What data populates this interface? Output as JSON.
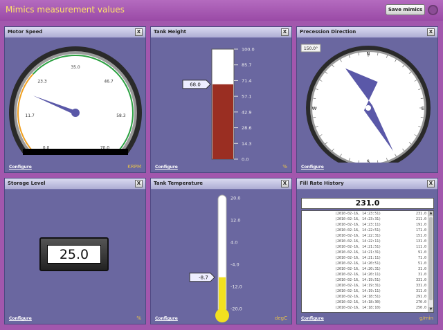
{
  "app": {
    "title": "Mimics measurement values",
    "save_label": "Save mimics"
  },
  "common": {
    "close_label": "X",
    "configure_label": "Configure"
  },
  "motor_speed": {
    "title": "Motor Speed",
    "unit": "KRPM",
    "value": 18.0,
    "min": 0,
    "max": 70,
    "tick_labels": [
      "0.0",
      "11.7",
      "23.3",
      "35.0",
      "46.7",
      "58.3",
      "70.0"
    ]
  },
  "tank_height": {
    "title": "Tank Height",
    "unit": "%",
    "value": 68.0,
    "value_label": "68.0",
    "min": 0,
    "max": 100,
    "tick_labels": [
      "0.0",
      "14.3",
      "28.6",
      "42.9",
      "57.1",
      "71.4",
      "85.7",
      "100.0"
    ]
  },
  "precession": {
    "title": "Precession Direction",
    "value": 150.0,
    "value_label": "150.0°",
    "directions": {
      "n": "N",
      "e": "E",
      "s": "S",
      "w": "W"
    }
  },
  "storage_level": {
    "title": "Storage Level",
    "unit": "%",
    "value_label": "25.0"
  },
  "tank_temperature": {
    "title": "Tank Temperature",
    "unit": "degC",
    "value": -8.7,
    "value_label": "-8.7",
    "min": -20,
    "max": 20,
    "tick_labels": [
      "-20.0",
      "-12.0",
      "-4.0",
      "4.0",
      "12.0",
      "20.0"
    ]
  },
  "fill_rate": {
    "title": "Fill Rate History",
    "unit": "g/min",
    "current_label": "231.0",
    "rows": [
      {
        "ts": "(2010-02-16, 14:23:51)",
        "val": "231.0"
      },
      {
        "ts": "(2010-02-16, 14:23:31)",
        "val": "211.0"
      },
      {
        "ts": "(2010-02-16, 14:23:11)",
        "val": "191.0"
      },
      {
        "ts": "(2010-02-16, 14:22:51)",
        "val": "171.0"
      },
      {
        "ts": "(2010-02-16, 14:22:31)",
        "val": "151.0"
      },
      {
        "ts": "(2010-02-16, 14:22:11)",
        "val": "131.0"
      },
      {
        "ts": "(2010-02-16, 14:21:51)",
        "val": "111.0"
      },
      {
        "ts": "(2010-02-16, 14:21:31)",
        "val": "91.0"
      },
      {
        "ts": "(2010-02-16, 14:21:11)",
        "val": "71.0"
      },
      {
        "ts": "(2010-02-16, 14:20:51)",
        "val": "51.0"
      },
      {
        "ts": "(2010-02-16, 14:20:31)",
        "val": "31.0"
      },
      {
        "ts": "(2010-02-16, 14:20:11)",
        "val": "31.0"
      },
      {
        "ts": "(2010-02-16, 14:19:51)",
        "val": "331.0"
      },
      {
        "ts": "(2010-02-16, 14:19:31)",
        "val": "331.0"
      },
      {
        "ts": "(2010-02-16, 14:19:11)",
        "val": "311.0"
      },
      {
        "ts": "(2010-02-16, 14:18:51)",
        "val": "291.0"
      },
      {
        "ts": "(2010-02-16, 14:18:30)",
        "val": "270.0"
      },
      {
        "ts": "(2010-02-16, 14:18:10)",
        "val": "250.0"
      }
    ]
  },
  "colors": {
    "background": "#a257ad",
    "panel": "#6a67a0",
    "accent_text": "#ffe36a",
    "gauge_arc_orange": "#f0a020",
    "gauge_arc_green": "#2aa040",
    "needle": "#5a58a8",
    "tank_fill": "#9a2e22",
    "thermo_fill": "#f2e020"
  },
  "icons": {
    "loader": "spinner-icon",
    "close": "close-icon"
  }
}
